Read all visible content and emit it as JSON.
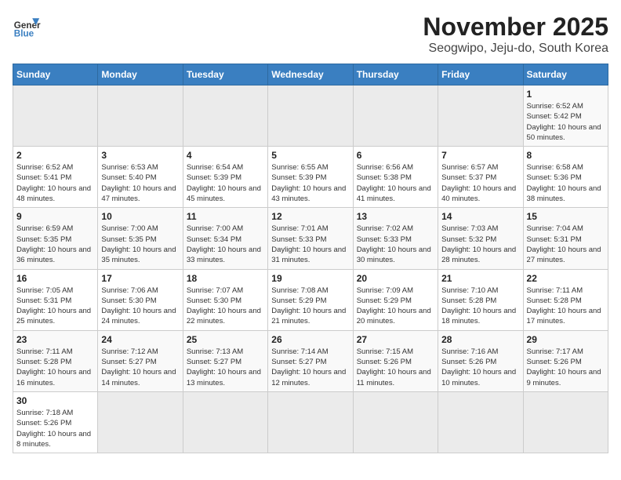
{
  "header": {
    "logo_line1": "General",
    "logo_line2": "Blue",
    "month": "November 2025",
    "location": "Seogwipo, Jeju-do, South Korea"
  },
  "weekdays": [
    "Sunday",
    "Monday",
    "Tuesday",
    "Wednesday",
    "Thursday",
    "Friday",
    "Saturday"
  ],
  "weeks": [
    [
      {
        "day": "",
        "sunrise": "",
        "sunset": "",
        "daylight": ""
      },
      {
        "day": "",
        "sunrise": "",
        "sunset": "",
        "daylight": ""
      },
      {
        "day": "",
        "sunrise": "",
        "sunset": "",
        "daylight": ""
      },
      {
        "day": "",
        "sunrise": "",
        "sunset": "",
        "daylight": ""
      },
      {
        "day": "",
        "sunrise": "",
        "sunset": "",
        "daylight": ""
      },
      {
        "day": "",
        "sunrise": "",
        "sunset": "",
        "daylight": ""
      },
      {
        "day": "1",
        "sunrise": "Sunrise: 6:52 AM",
        "sunset": "Sunset: 5:42 PM",
        "daylight": "Daylight: 10 hours and 50 minutes."
      }
    ],
    [
      {
        "day": "2",
        "sunrise": "Sunrise: 6:52 AM",
        "sunset": "Sunset: 5:41 PM",
        "daylight": "Daylight: 10 hours and 48 minutes."
      },
      {
        "day": "3",
        "sunrise": "Sunrise: 6:53 AM",
        "sunset": "Sunset: 5:40 PM",
        "daylight": "Daylight: 10 hours and 47 minutes."
      },
      {
        "day": "4",
        "sunrise": "Sunrise: 6:54 AM",
        "sunset": "Sunset: 5:39 PM",
        "daylight": "Daylight: 10 hours and 45 minutes."
      },
      {
        "day": "5",
        "sunrise": "Sunrise: 6:55 AM",
        "sunset": "Sunset: 5:39 PM",
        "daylight": "Daylight: 10 hours and 43 minutes."
      },
      {
        "day": "6",
        "sunrise": "Sunrise: 6:56 AM",
        "sunset": "Sunset: 5:38 PM",
        "daylight": "Daylight: 10 hours and 41 minutes."
      },
      {
        "day": "7",
        "sunrise": "Sunrise: 6:57 AM",
        "sunset": "Sunset: 5:37 PM",
        "daylight": "Daylight: 10 hours and 40 minutes."
      },
      {
        "day": "8",
        "sunrise": "Sunrise: 6:58 AM",
        "sunset": "Sunset: 5:36 PM",
        "daylight": "Daylight: 10 hours and 38 minutes."
      }
    ],
    [
      {
        "day": "9",
        "sunrise": "Sunrise: 6:59 AM",
        "sunset": "Sunset: 5:35 PM",
        "daylight": "Daylight: 10 hours and 36 minutes."
      },
      {
        "day": "10",
        "sunrise": "Sunrise: 7:00 AM",
        "sunset": "Sunset: 5:35 PM",
        "daylight": "Daylight: 10 hours and 35 minutes."
      },
      {
        "day": "11",
        "sunrise": "Sunrise: 7:00 AM",
        "sunset": "Sunset: 5:34 PM",
        "daylight": "Daylight: 10 hours and 33 minutes."
      },
      {
        "day": "12",
        "sunrise": "Sunrise: 7:01 AM",
        "sunset": "Sunset: 5:33 PM",
        "daylight": "Daylight: 10 hours and 31 minutes."
      },
      {
        "day": "13",
        "sunrise": "Sunrise: 7:02 AM",
        "sunset": "Sunset: 5:33 PM",
        "daylight": "Daylight: 10 hours and 30 minutes."
      },
      {
        "day": "14",
        "sunrise": "Sunrise: 7:03 AM",
        "sunset": "Sunset: 5:32 PM",
        "daylight": "Daylight: 10 hours and 28 minutes."
      },
      {
        "day": "15",
        "sunrise": "Sunrise: 7:04 AM",
        "sunset": "Sunset: 5:31 PM",
        "daylight": "Daylight: 10 hours and 27 minutes."
      }
    ],
    [
      {
        "day": "16",
        "sunrise": "Sunrise: 7:05 AM",
        "sunset": "Sunset: 5:31 PM",
        "daylight": "Daylight: 10 hours and 25 minutes."
      },
      {
        "day": "17",
        "sunrise": "Sunrise: 7:06 AM",
        "sunset": "Sunset: 5:30 PM",
        "daylight": "Daylight: 10 hours and 24 minutes."
      },
      {
        "day": "18",
        "sunrise": "Sunrise: 7:07 AM",
        "sunset": "Sunset: 5:30 PM",
        "daylight": "Daylight: 10 hours and 22 minutes."
      },
      {
        "day": "19",
        "sunrise": "Sunrise: 7:08 AM",
        "sunset": "Sunset: 5:29 PM",
        "daylight": "Daylight: 10 hours and 21 minutes."
      },
      {
        "day": "20",
        "sunrise": "Sunrise: 7:09 AM",
        "sunset": "Sunset: 5:29 PM",
        "daylight": "Daylight: 10 hours and 20 minutes."
      },
      {
        "day": "21",
        "sunrise": "Sunrise: 7:10 AM",
        "sunset": "Sunset: 5:28 PM",
        "daylight": "Daylight: 10 hours and 18 minutes."
      },
      {
        "day": "22",
        "sunrise": "Sunrise: 7:11 AM",
        "sunset": "Sunset: 5:28 PM",
        "daylight": "Daylight: 10 hours and 17 minutes."
      }
    ],
    [
      {
        "day": "23",
        "sunrise": "Sunrise: 7:11 AM",
        "sunset": "Sunset: 5:28 PM",
        "daylight": "Daylight: 10 hours and 16 minutes."
      },
      {
        "day": "24",
        "sunrise": "Sunrise: 7:12 AM",
        "sunset": "Sunset: 5:27 PM",
        "daylight": "Daylight: 10 hours and 14 minutes."
      },
      {
        "day": "25",
        "sunrise": "Sunrise: 7:13 AM",
        "sunset": "Sunset: 5:27 PM",
        "daylight": "Daylight: 10 hours and 13 minutes."
      },
      {
        "day": "26",
        "sunrise": "Sunrise: 7:14 AM",
        "sunset": "Sunset: 5:27 PM",
        "daylight": "Daylight: 10 hours and 12 minutes."
      },
      {
        "day": "27",
        "sunrise": "Sunrise: 7:15 AM",
        "sunset": "Sunset: 5:26 PM",
        "daylight": "Daylight: 10 hours and 11 minutes."
      },
      {
        "day": "28",
        "sunrise": "Sunrise: 7:16 AM",
        "sunset": "Sunset: 5:26 PM",
        "daylight": "Daylight: 10 hours and 10 minutes."
      },
      {
        "day": "29",
        "sunrise": "Sunrise: 7:17 AM",
        "sunset": "Sunset: 5:26 PM",
        "daylight": "Daylight: 10 hours and 9 minutes."
      }
    ],
    [
      {
        "day": "30",
        "sunrise": "Sunrise: 7:18 AM",
        "sunset": "Sunset: 5:26 PM",
        "daylight": "Daylight: 10 hours and 8 minutes."
      },
      {
        "day": "",
        "sunrise": "",
        "sunset": "",
        "daylight": ""
      },
      {
        "day": "",
        "sunrise": "",
        "sunset": "",
        "daylight": ""
      },
      {
        "day": "",
        "sunrise": "",
        "sunset": "",
        "daylight": ""
      },
      {
        "day": "",
        "sunrise": "",
        "sunset": "",
        "daylight": ""
      },
      {
        "day": "",
        "sunrise": "",
        "sunset": "",
        "daylight": ""
      },
      {
        "day": "",
        "sunrise": "",
        "sunset": "",
        "daylight": ""
      }
    ]
  ]
}
